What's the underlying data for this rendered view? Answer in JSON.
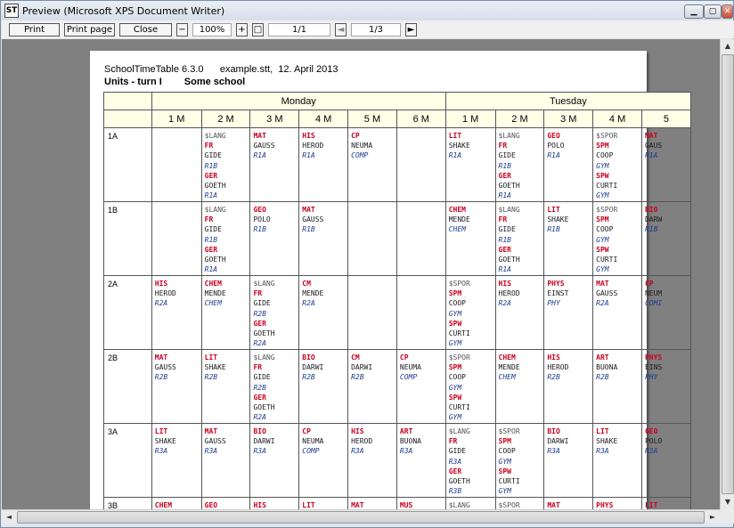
{
  "window": {
    "title": "Preview (Microsoft XPS Document Writer)",
    "app_icon": "ST"
  },
  "toolbar": {
    "print": "Print",
    "print_page": "Print page",
    "close": "Close",
    "zoom_out": "−",
    "zoom": "100%",
    "zoom_in": "+",
    "fit": "□",
    "page_field": "1/1",
    "nav_prev": "◄",
    "page_of": "1/3",
    "nav_next": "►"
  },
  "page": {
    "line1": "SchoolTimeTable 6.3.0      example.stt,  12. April 2013",
    "units": "Units - turn I",
    "school": "Some school"
  },
  "days": [
    "Monday",
    "Tuesday"
  ],
  "periods": [
    "1 M",
    "2 M",
    "3 M",
    "4 M",
    "5 M",
    "6 M",
    "1 M",
    "2 M",
    "3 M",
    "4 M",
    "5"
  ],
  "rows": [
    {
      "label": "1A",
      "cells": [
        [],
        [
          [
            "$LANG",
            "t"
          ],
          [
            "FR",
            "r"
          ],
          [
            "GIDE",
            "k"
          ],
          [
            "R1B",
            "m"
          ],
          [
            "GER",
            "r"
          ],
          [
            "GOETH",
            "k"
          ],
          [
            "R1A",
            "m"
          ]
        ],
        [
          [
            "MAT",
            "r"
          ],
          [
            "GAUSS",
            "k"
          ],
          [
            "R1A",
            "m"
          ]
        ],
        [
          [
            "HIS",
            "r"
          ],
          [
            "HEROD",
            "k"
          ],
          [
            "R1A",
            "m"
          ]
        ],
        [
          [
            "CP",
            "r"
          ],
          [
            "NEUMA",
            "k"
          ],
          [
            "COMP",
            "m"
          ]
        ],
        [],
        [
          [
            "LIT",
            "r"
          ],
          [
            "SHAKE",
            "k"
          ],
          [
            "R1A",
            "m"
          ]
        ],
        [
          [
            "$LANG",
            "t"
          ],
          [
            "FR",
            "r"
          ],
          [
            "GIDE",
            "k"
          ],
          [
            "R1B",
            "m"
          ],
          [
            "GER",
            "r"
          ],
          [
            "GOETH",
            "k"
          ],
          [
            "R1A",
            "m"
          ]
        ],
        [
          [
            "GEO",
            "r"
          ],
          [
            "POLO",
            "k"
          ],
          [
            "R1A",
            "m"
          ]
        ],
        [
          [
            "$SPOR",
            "t"
          ],
          [
            "SPM",
            "r"
          ],
          [
            "COOP",
            "k"
          ],
          [
            "GYM",
            "m"
          ],
          [
            "SPW",
            "r"
          ],
          [
            "CURTI",
            "k"
          ],
          [
            "GYM",
            "m"
          ]
        ],
        [
          [
            "MAT",
            "r"
          ],
          [
            "GAUS",
            "k"
          ],
          [
            "R1A",
            "m"
          ]
        ]
      ]
    },
    {
      "label": "1B",
      "cells": [
        [],
        [
          [
            "$LANG",
            "t"
          ],
          [
            "FR",
            "r"
          ],
          [
            "GIDE",
            "k"
          ],
          [
            "R1B",
            "m"
          ],
          [
            "GER",
            "r"
          ],
          [
            "GOETH",
            "k"
          ],
          [
            "R1A",
            "m"
          ]
        ],
        [
          [
            "GEO",
            "r"
          ],
          [
            "POLO",
            "k"
          ],
          [
            "R1B",
            "m"
          ]
        ],
        [
          [
            "MAT",
            "r"
          ],
          [
            "GAUSS",
            "k"
          ],
          [
            "R1B",
            "m"
          ]
        ],
        [],
        [],
        [
          [
            "CHEM",
            "r"
          ],
          [
            "MENDE",
            "k"
          ],
          [
            "CHEM",
            "m"
          ]
        ],
        [
          [
            "$LANG",
            "t"
          ],
          [
            "FR",
            "r"
          ],
          [
            "GIDE",
            "k"
          ],
          [
            "R1B",
            "m"
          ],
          [
            "GER",
            "r"
          ],
          [
            "GOETH",
            "k"
          ],
          [
            "R1A",
            "m"
          ]
        ],
        [
          [
            "LIT",
            "r"
          ],
          [
            "SHAKE",
            "k"
          ],
          [
            "R1B",
            "m"
          ]
        ],
        [
          [
            "$SPOR",
            "t"
          ],
          [
            "SPM",
            "r"
          ],
          [
            "COOP",
            "k"
          ],
          [
            "GYM",
            "m"
          ],
          [
            "SPW",
            "r"
          ],
          [
            "CURTI",
            "k"
          ],
          [
            "GYM",
            "m"
          ]
        ],
        [
          [
            "BIO",
            "r"
          ],
          [
            "DARW",
            "k"
          ],
          [
            "R1B",
            "m"
          ]
        ]
      ]
    },
    {
      "label": "2A",
      "cells": [
        [
          [
            "HIS",
            "r"
          ],
          [
            "HEROD",
            "k"
          ],
          [
            "R2A",
            "m"
          ]
        ],
        [
          [
            "CHEM",
            "r"
          ],
          [
            "MENDE",
            "k"
          ],
          [
            "CHEM",
            "m"
          ]
        ],
        [
          [
            "$LANG",
            "t"
          ],
          [
            "FR",
            "r"
          ],
          [
            "GIDE",
            "k"
          ],
          [
            "R2B",
            "m"
          ],
          [
            "GER",
            "r"
          ],
          [
            "GOETH",
            "k"
          ],
          [
            "R2A",
            "m"
          ]
        ],
        [
          [
            "CM",
            "r"
          ],
          [
            "MENDE",
            "k"
          ],
          [
            "R2A",
            "m"
          ]
        ],
        [],
        [],
        [
          [
            "$SPOR",
            "t"
          ],
          [
            "SPM",
            "r"
          ],
          [
            "COOP",
            "k"
          ],
          [
            "GYM",
            "m"
          ],
          [
            "SPW",
            "r"
          ],
          [
            "CURTI",
            "k"
          ],
          [
            "GYM",
            "m"
          ]
        ],
        [
          [
            "HIS",
            "r"
          ],
          [
            "HEROD",
            "k"
          ],
          [
            "R2A",
            "m"
          ]
        ],
        [
          [
            "PHYS",
            "r"
          ],
          [
            "EINST",
            "k"
          ],
          [
            "PHY",
            "m"
          ]
        ],
        [
          [
            "MAT",
            "r"
          ],
          [
            "GAUSS",
            "k"
          ],
          [
            "R2A",
            "m"
          ]
        ],
        [
          [
            "CP",
            "r"
          ],
          [
            "NEUM",
            "k"
          ],
          [
            "COMI",
            "m"
          ]
        ]
      ]
    },
    {
      "label": "2B",
      "cells": [
        [
          [
            "MAT",
            "r"
          ],
          [
            "GAUSS",
            "k"
          ],
          [
            "R2B",
            "m"
          ]
        ],
        [
          [
            "LIT",
            "r"
          ],
          [
            "SHAKE",
            "k"
          ],
          [
            "R2B",
            "m"
          ]
        ],
        [
          [
            "$LANG",
            "t"
          ],
          [
            "FR",
            "r"
          ],
          [
            "GIDE",
            "k"
          ],
          [
            "R2B",
            "m"
          ],
          [
            "GER",
            "r"
          ],
          [
            "GOETH",
            "k"
          ],
          [
            "R2A",
            "m"
          ]
        ],
        [
          [
            "BIO",
            "r"
          ],
          [
            "DARWI",
            "k"
          ],
          [
            "R2B",
            "m"
          ]
        ],
        [
          [
            "CM",
            "r"
          ],
          [
            "DARWI",
            "k"
          ],
          [
            "R2B",
            "m"
          ]
        ],
        [
          [
            "CP",
            "r"
          ],
          [
            "NEUMA",
            "k"
          ],
          [
            "COMP",
            "m"
          ]
        ],
        [
          [
            "$SPOR",
            "t"
          ],
          [
            "SPM",
            "r"
          ],
          [
            "COOP",
            "k"
          ],
          [
            "GYM",
            "m"
          ],
          [
            "SPW",
            "r"
          ],
          [
            "CURTI",
            "k"
          ],
          [
            "GYM",
            "m"
          ]
        ],
        [
          [
            "CHEM",
            "r"
          ],
          [
            "MENDE",
            "k"
          ],
          [
            "CHEM",
            "m"
          ]
        ],
        [
          [
            "HIS",
            "r"
          ],
          [
            "HEROD",
            "k"
          ],
          [
            "R2B",
            "m"
          ]
        ],
        [
          [
            "ART",
            "r"
          ],
          [
            "BUONA",
            "k"
          ],
          [
            "R2B",
            "m"
          ]
        ],
        [
          [
            "PHYS",
            "r"
          ],
          [
            "EINS",
            "k"
          ],
          [
            "PHY",
            "m"
          ]
        ]
      ]
    },
    {
      "label": "3A",
      "cells": [
        [
          [
            "LIT",
            "r"
          ],
          [
            "SHAKE",
            "k"
          ],
          [
            "R3A",
            "m"
          ]
        ],
        [
          [
            "MAT",
            "r"
          ],
          [
            "GAUSS",
            "k"
          ],
          [
            "R3A",
            "m"
          ]
        ],
        [
          [
            "BIO",
            "r"
          ],
          [
            "DARWI",
            "k"
          ],
          [
            "R3A",
            "m"
          ]
        ],
        [
          [
            "CP",
            "r"
          ],
          [
            "NEUMA",
            "k"
          ],
          [
            "COMP",
            "m"
          ]
        ],
        [
          [
            "HIS",
            "r"
          ],
          [
            "HEROD",
            "k"
          ],
          [
            "R3A",
            "m"
          ]
        ],
        [
          [
            "ART",
            "r"
          ],
          [
            "BUONA",
            "k"
          ],
          [
            "R3A",
            "m"
          ]
        ],
        [
          [
            "$LANG",
            "t"
          ],
          [
            "FR",
            "r"
          ],
          [
            "GIDE",
            "k"
          ],
          [
            "R3A",
            "m"
          ],
          [
            "GER",
            "r"
          ],
          [
            "GOETH",
            "k"
          ],
          [
            "R3B",
            "m"
          ]
        ],
        [
          [
            "$SPOR",
            "t"
          ],
          [
            "SPM",
            "r"
          ],
          [
            "COOP",
            "k"
          ],
          [
            "GYM",
            "m"
          ],
          [
            "SPW",
            "r"
          ],
          [
            "CURTI",
            "k"
          ],
          [
            "GYM",
            "m"
          ]
        ],
        [
          [
            "BIO",
            "r"
          ],
          [
            "DARWI",
            "k"
          ],
          [
            "R3A",
            "m"
          ]
        ],
        [
          [
            "LIT",
            "r"
          ],
          [
            "SHAKE",
            "k"
          ],
          [
            "R3A",
            "m"
          ]
        ],
        [
          [
            "GEO",
            "r"
          ],
          [
            "POLO",
            "k"
          ],
          [
            "R3A",
            "m"
          ]
        ]
      ]
    },
    {
      "label": "3B",
      "cells": [
        [
          [
            "CHEM",
            "r"
          ]
        ],
        [
          [
            "GEO",
            "r"
          ]
        ],
        [
          [
            "HIS",
            "r"
          ]
        ],
        [
          [
            "LIT",
            "r"
          ]
        ],
        [
          [
            "MAT",
            "r"
          ]
        ],
        [
          [
            "MUS",
            "r"
          ]
        ],
        [
          [
            "$LANG",
            "t"
          ]
        ],
        [
          [
            "$SPOR",
            "t"
          ]
        ],
        [
          [
            "MAT",
            "r"
          ]
        ],
        [
          [
            "PHYS",
            "r"
          ]
        ],
        [
          [
            "LIT",
            "r"
          ]
        ]
      ]
    }
  ]
}
